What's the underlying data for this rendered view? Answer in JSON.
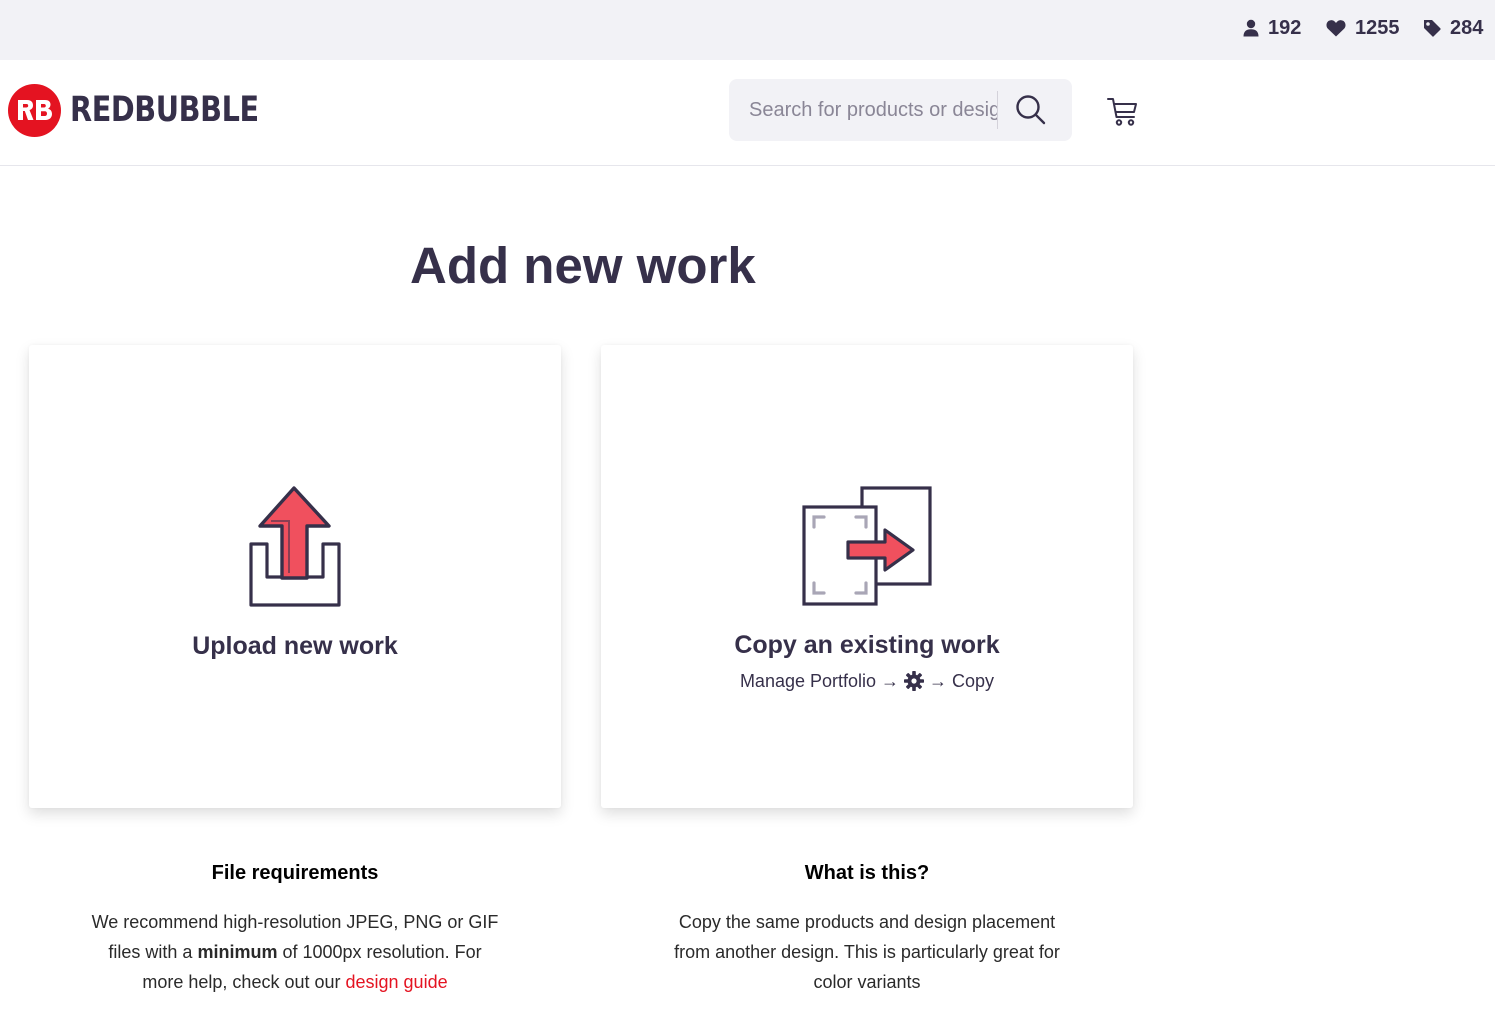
{
  "stats": {
    "followers": "192",
    "favorites": "1255",
    "tags": "284"
  },
  "header": {
    "logo_mark": "RB",
    "logo_text": "REDBUBBLE",
    "search_placeholder": "Search for products or designs"
  },
  "page": {
    "title": "Add new work"
  },
  "cards": {
    "upload": {
      "title": "Upload new work"
    },
    "copy": {
      "title": "Copy an existing work",
      "hint_start": "Manage Portfolio →",
      "hint_end": "→ Copy"
    }
  },
  "info": {
    "files": {
      "heading": "File requirements",
      "text_1": "We recommend high-resolution JPEG, PNG or GIF files with a ",
      "bold": "minimum",
      "text_2": " of 1000px resolution. For more help, check out our ",
      "link": "design guide"
    },
    "what": {
      "heading": "What is this?",
      "text": "Copy the same products and design placement from another design. This is particularly great for color variants"
    }
  },
  "colors": {
    "brand_red": "#e41321",
    "text_dark": "#36304a",
    "illustration_red": "#f0505e",
    "bar_bg": "#f2f2f6"
  }
}
